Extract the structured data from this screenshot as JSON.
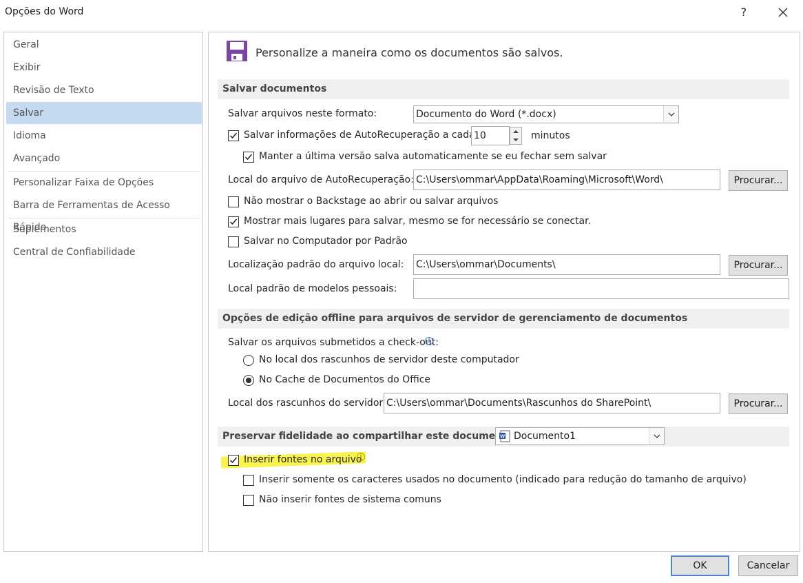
{
  "window": {
    "title": "Opções do Word",
    "help_label": "?"
  },
  "sidebar": {
    "items": [
      {
        "label": "Geral"
      },
      {
        "label": "Exibir"
      },
      {
        "label": "Revisão de Texto"
      },
      {
        "label": "Salvar",
        "selected": true
      },
      {
        "label": "Idioma"
      },
      {
        "label": "Avançado"
      },
      {
        "label": "Personalizar Faixa de Opções"
      },
      {
        "label": "Barra de Ferramentas de Acesso Rápido"
      },
      {
        "label": "Suplementos"
      },
      {
        "label": "Central de Confiabilidade"
      }
    ]
  },
  "main": {
    "heading": "Personalize a maneira como os documentos são salvos.",
    "save_docs": {
      "section_title": "Salvar documentos",
      "format_label": "Salvar arquivos neste formato:",
      "format_value": "Documento do Word (*.docx)",
      "autorecover_label": "Salvar informações de AutoRecuperação a cada",
      "autorecover_checked": true,
      "autorecover_minutes": "10",
      "minutes_label": "minutos",
      "keep_last_label": "Manter a última versão salva automaticamente se eu fechar sem salvar",
      "keep_last_checked": true,
      "autorecover_location_label": "Local do arquivo de AutoRecuperação:",
      "autorecover_location_value": "C:\\Users\\ommar\\AppData\\Roaming\\Microsoft\\Word\\",
      "browse_label": "Procurar...",
      "no_backstage_label": "Não mostrar o Backstage ao abrir ou salvar arquivos",
      "no_backstage_checked": false,
      "more_places_label": "Mostrar mais lugares para salvar, mesmo se for necessário se conectar.",
      "more_places_checked": true,
      "save_to_computer_label": "Salvar no Computador por Padrão",
      "save_to_computer_checked": false,
      "default_local_label": "Localização padrão do arquivo local:",
      "default_local_value": "C:\\Users\\ommar\\Documents\\",
      "templates_label": "Local padrão de modelos pessoais:",
      "templates_value": ""
    },
    "offline": {
      "section_title": "Opções de edição offline para arquivos de servidor de gerenciamento de documentos",
      "checkout_label": "Salvar os arquivos submetidos a check-out:",
      "radio_server_label": "No local dos rascunhos de servidor deste computador",
      "radio_cache_label": "No Cache de Documentos do Office",
      "selected_option": "cache",
      "drafts_label": "Local dos rascunhos do servidor:",
      "drafts_value": "C:\\Users\\ommar\\Documents\\Rascunhos do SharePoint\\"
    },
    "fidelity": {
      "section_title": "Preservar fidelidade ao compartilhar este documento:",
      "document_value": "Documento1",
      "embed_fonts_label": "Inserir fontes no arquivo",
      "embed_fonts_checked": true,
      "only_used_label": "Inserir somente os caracteres usados no documento (indicado para redução do tamanho de arquivo)",
      "only_used_checked": false,
      "no_common_label": "Não inserir fontes de sistema comuns",
      "no_common_checked": false
    }
  },
  "footer": {
    "ok_label": "OK",
    "cancel_label": "Cancelar"
  },
  "colors": {
    "accent": "#4a86c8",
    "selected_nav": "#c5d9f1",
    "highlight": "#f5f000",
    "save_icon": "#7b46a6"
  }
}
